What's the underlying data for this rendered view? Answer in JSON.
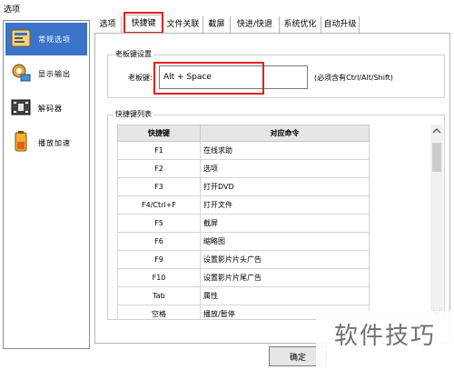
{
  "window": {
    "title": "选项"
  },
  "sidebar": {
    "items": [
      {
        "label": "常规选项",
        "icon": "settings-panel-icon",
        "selected": true
      },
      {
        "label": "显示输出",
        "icon": "display-output-icon",
        "selected": false
      },
      {
        "label": "解码器",
        "icon": "film-decoder-icon",
        "selected": false
      },
      {
        "label": "播放加速",
        "icon": "battery-acceleration-icon",
        "selected": false
      }
    ]
  },
  "tabs": [
    {
      "label": "选项",
      "active": false
    },
    {
      "label": "快捷键",
      "active": true
    },
    {
      "label": "文件关联",
      "active": false
    },
    {
      "label": "截屏",
      "active": false
    },
    {
      "label": "快进/快退",
      "active": false
    },
    {
      "label": "系统优化",
      "active": false
    },
    {
      "label": "自动升级",
      "active": false
    }
  ],
  "bosskey": {
    "group_title": "老板键设置",
    "label": "老板键:",
    "value": "Alt + Space",
    "hint": "(必须含有Ctrl/Alt/Shift)"
  },
  "shortcuts": {
    "group_title": "快捷键列表",
    "columns": [
      "快捷键",
      "对应命令"
    ],
    "rows": [
      [
        "F1",
        "在线求助"
      ],
      [
        "F2",
        "选项"
      ],
      [
        "F3",
        "打开DVD"
      ],
      [
        "F4/Ctrl+F",
        "打开文件"
      ],
      [
        "F5",
        "截屏"
      ],
      [
        "F6",
        "缩略图"
      ],
      [
        "F9",
        "设置影片片头广告"
      ],
      [
        "F10",
        "设置影片片尾广告"
      ],
      [
        "Tab",
        "属性"
      ],
      [
        "空格",
        "播放/暂停"
      ]
    ]
  },
  "footer": {
    "ok_label": "确定"
  },
  "watermark": {
    "text": "软件技巧"
  },
  "colors": {
    "selected": "#3a73c8",
    "highlight": "#e02020"
  }
}
